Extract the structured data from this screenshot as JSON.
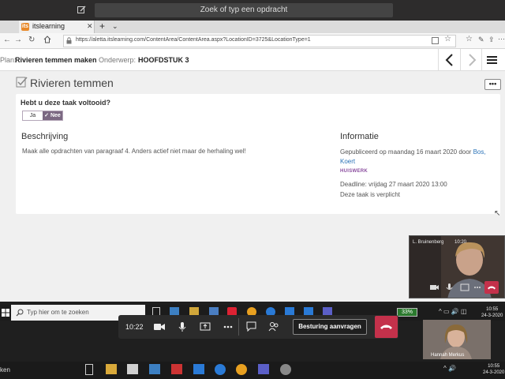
{
  "teams": {
    "search_placeholder": "Zoek of typ een opdracht"
  },
  "browser": {
    "tab_title": "itslearning",
    "favicon_text": "its",
    "url": "https://aletta.itslearning.com/ContentArea/ContentArea.aspx?LocationID=3725&LocationType=1"
  },
  "header": {
    "plan_label": "Plan:",
    "plan_value": "Rivieren temmen maken",
    "subject_label": "Onderwerp:",
    "subject_value": "HOOFDSTUK 3"
  },
  "task": {
    "title": "Rivieren temmen",
    "more_label": "•••",
    "question": "Hebt u deze taak voltooid?",
    "yes_label": "Ja",
    "no_label": "✓ Nee",
    "description_heading": "Beschrijving",
    "description_text": "Maak alle opdrachten van paragraaf 4. Anders actief niet maar de herhaling wel!",
    "info_heading": "Informatie",
    "published_prefix": "Gepubliceerd op maandag 16 maart 2020 door ",
    "published_author": "Bos, Koert",
    "badge": "HUISWERK",
    "deadline": "Deadline: vrijdag 27 maart 2020 13:00",
    "required": "Deze taak is verplicht"
  },
  "video_tile": {
    "name": "L. Bruinenberg",
    "time": "10:20"
  },
  "meeting": {
    "elapsed": "10:22",
    "request_control_label": "Besturing aanvragen"
  },
  "participant2": {
    "name": "Hannah Merkus"
  },
  "taskbar": {
    "search_placeholder": "Typ hier om te zoeken",
    "battery": "33%",
    "time": "10:55",
    "date": "24-3-2020",
    "bottom_search_text": "ken"
  },
  "colors": {
    "accent_purple": "#7b6882",
    "hangup_red": "#c4314b",
    "link_blue": "#2c74b8"
  }
}
